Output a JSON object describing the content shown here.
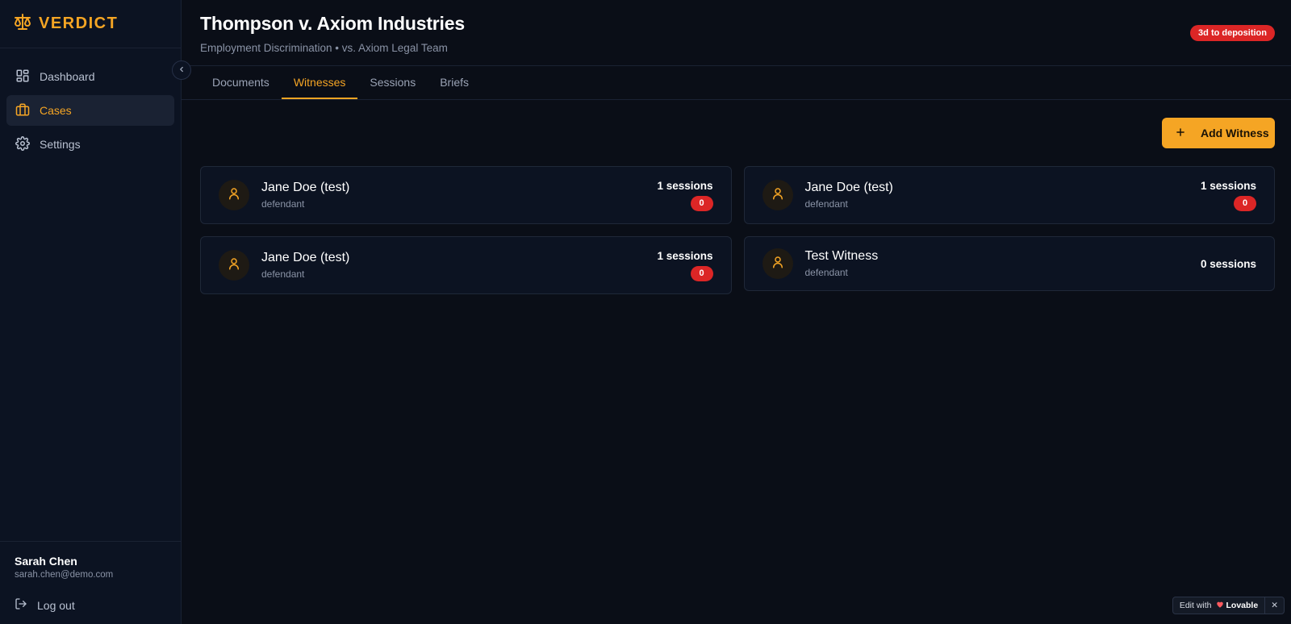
{
  "brand": {
    "name": "VERDICT",
    "accent": "#f5a524"
  },
  "sidebar": {
    "items": [
      {
        "label": "Dashboard",
        "icon": "grid-icon",
        "active": false
      },
      {
        "label": "Cases",
        "icon": "briefcase-icon",
        "active": true
      },
      {
        "label": "Settings",
        "icon": "gear-icon",
        "active": false
      }
    ],
    "user": {
      "name": "Sarah Chen",
      "email": "sarah.chen@demo.com"
    },
    "logout_label": "Log out"
  },
  "header": {
    "title": "Thompson v. Axiom Industries",
    "subtitle": "Employment Discrimination • vs. Axiom Legal Team",
    "deadline_badge": "3d to deposition"
  },
  "tabs": [
    {
      "label": "Documents",
      "active": false
    },
    {
      "label": "Witnesses",
      "active": true
    },
    {
      "label": "Sessions",
      "active": false
    },
    {
      "label": "Briefs",
      "active": false
    }
  ],
  "toolbar": {
    "add_label": "Add Witness"
  },
  "witnesses": [
    {
      "name": "Jane Doe (test)",
      "role": "defendant",
      "sessions": "1 sessions",
      "badge": "0"
    },
    {
      "name": "Jane Doe (test)",
      "role": "defendant",
      "sessions": "1 sessions",
      "badge": "0"
    },
    {
      "name": "Jane Doe (test)",
      "role": "defendant",
      "sessions": "1 sessions",
      "badge": "0"
    },
    {
      "name": "Test Witness",
      "role": "defendant",
      "sessions": "0 sessions",
      "badge": null
    }
  ],
  "lovable": {
    "prefix": "Edit with",
    "brand": "Lovable",
    "close": "✕"
  },
  "colors": {
    "background": "#0a0e17",
    "panel": "#0c1322",
    "danger": "#dc2626"
  }
}
